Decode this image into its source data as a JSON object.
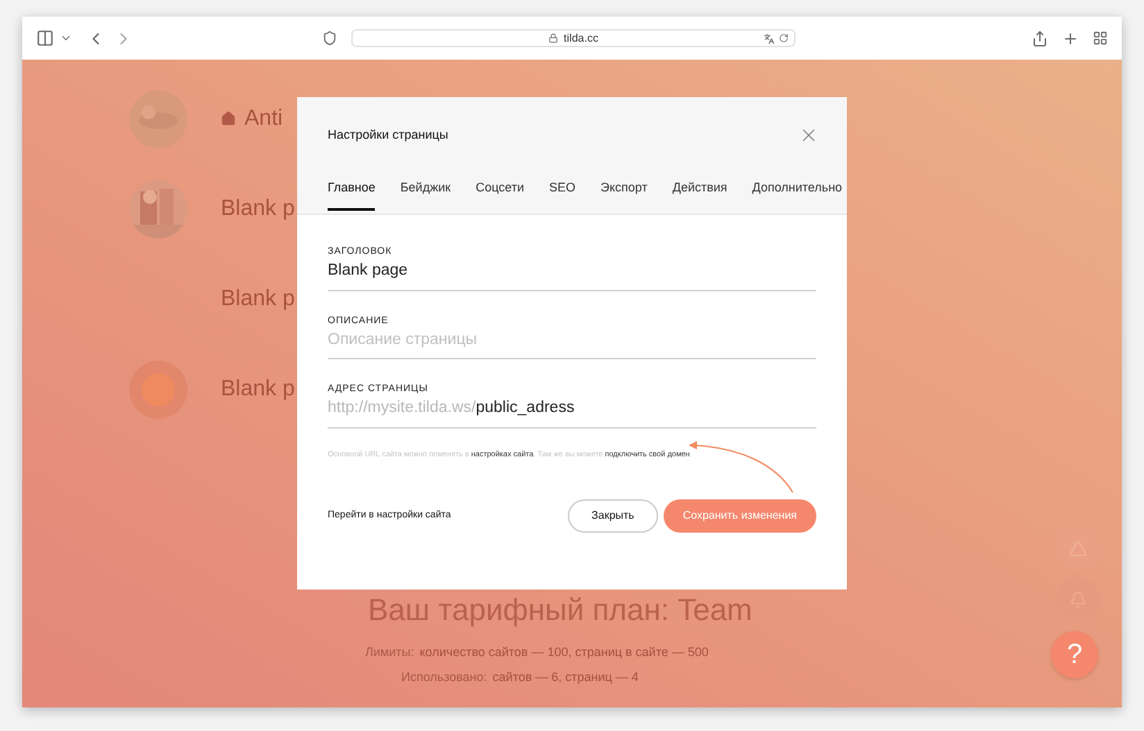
{
  "browser": {
    "url": "tilda.cc"
  },
  "background": {
    "rows": [
      {
        "title": "Anti",
        "kind": "home"
      },
      {
        "title": "Blank p"
      },
      {
        "title": "Blank p",
        "kind": "plain"
      },
      {
        "title": "Blank p",
        "kind": "dot"
      }
    ],
    "plan_title": "Ваш тарифный план: Team",
    "limits": [
      {
        "label": "Лимиты:",
        "value": "количество сайтов — 100, страниц в сайте — 500"
      },
      {
        "label": "Использовано:",
        "value": "сайтов — 6, страниц — 4"
      }
    ],
    "help_button": "?"
  },
  "dialog": {
    "title": "Настройки страницы",
    "tabs": [
      {
        "label": "Главное",
        "selected": true
      },
      {
        "label": "Бейджик",
        "selected": false
      },
      {
        "label": "Соцсети",
        "selected": false
      },
      {
        "label": "SEO",
        "selected": false
      },
      {
        "label": "Экспорт",
        "selected": false
      },
      {
        "label": "Действия",
        "selected": false
      },
      {
        "label": "Дополнительно",
        "selected": false
      }
    ],
    "fields": [
      {
        "label": "ЗАГОЛОВОК",
        "value": "Blank page"
      },
      {
        "label": "ОПИСАНИЕ",
        "placeholder": "Описание страницы"
      },
      {
        "label": "АДРЕС СТРАНИЦЫ",
        "prefix": "http://mysite.tilda.ws/",
        "value": "public_adress"
      }
    ],
    "hint": [
      {
        "kind": "text",
        "text": "Основной URL сайта можно поменять в"
      },
      {
        "kind": "link",
        "text": "настройках сайта"
      },
      {
        "kind": "text",
        "text": ". Там же вы можете"
      },
      {
        "kind": "link",
        "text": "подключить свой домен"
      },
      {
        "kind": "text",
        "text": "."
      }
    ],
    "settings_link": "Перейти в настройки сайта",
    "buttons": [
      {
        "label": "Закрыть",
        "kind": "secondary"
      },
      {
        "label": "Сохранить изменения",
        "kind": "primary"
      }
    ]
  }
}
